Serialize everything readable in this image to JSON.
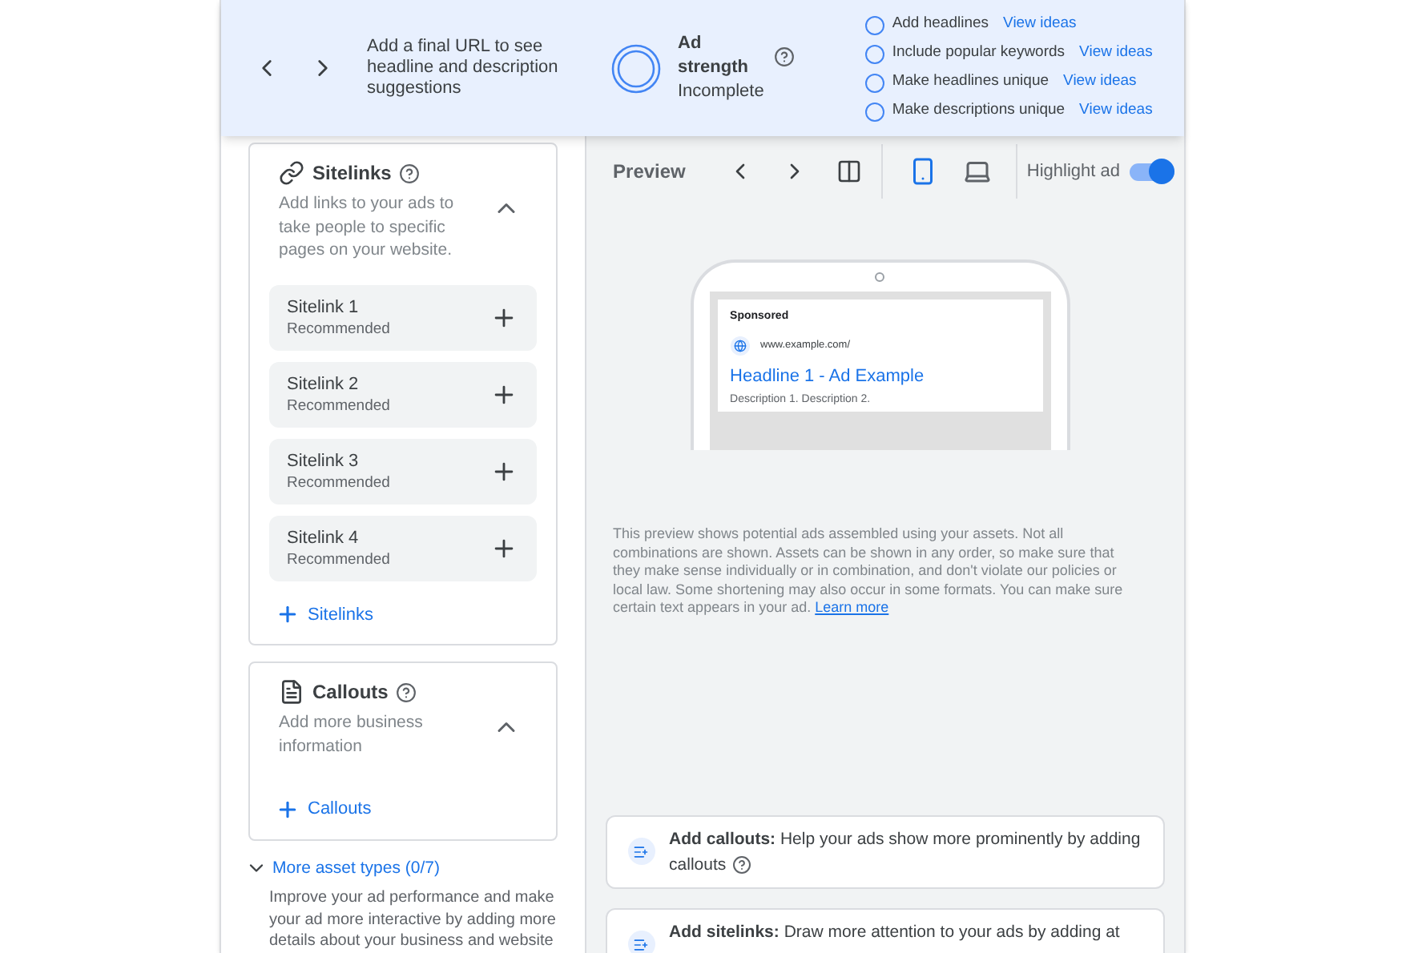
{
  "banner": {
    "suggestion": "Add a final URL to see headline and description suggestions",
    "strength_label": "Ad strength",
    "strength_status": "Incomplete",
    "checklist": [
      {
        "label": "Add headlines",
        "link": "View ideas",
        "checked": false
      },
      {
        "label": "Include popular keywords",
        "link": "View ideas",
        "checked": false
      },
      {
        "label": "Make headlines unique",
        "link": "View ideas",
        "checked": false
      },
      {
        "label": "Make descriptions unique",
        "link": "View ideas",
        "checked": false
      }
    ]
  },
  "asset_sections": [
    {
      "kind": "sitelinks",
      "title": "Sitelinks",
      "description": "Add links to your ads to take people to specific pages on your website.",
      "expanded": true,
      "items": [
        {
          "title": "Sitelink 1",
          "subtitle": "Recommended"
        },
        {
          "title": "Sitelink 2",
          "subtitle": "Recommended"
        },
        {
          "title": "Sitelink 3",
          "subtitle": "Recommended"
        },
        {
          "title": "Sitelink 4",
          "subtitle": "Recommended"
        }
      ],
      "add_label": "Sitelinks"
    },
    {
      "kind": "callouts",
      "title": "Callouts",
      "description": "Add more business information",
      "expanded": true,
      "add_label": "Callouts"
    }
  ],
  "more_assets": {
    "label": "More asset types (0/7)",
    "expanded": true,
    "description": "Improve your ad performance and make your ad more interactive by adding more details about your business and website"
  },
  "preview": {
    "title": "Preview",
    "devices": [
      {
        "kind": "mobile",
        "selected": true
      },
      {
        "kind": "desktop",
        "selected": false
      }
    ],
    "highlight": {
      "label": "Highlight ad",
      "on": true
    },
    "ad": {
      "sponsored": "Sponsored",
      "url": "www.example.com/",
      "headline": "Headline 1 - Ad Example",
      "description": "Description 1. Description 2."
    },
    "disclaimer": "This preview shows potential ads assembled using your assets. Not all combinations are shown. Assets can be shown in any order, so make sure that they make sense individually or in combination, and don't violate our policies or local law. Some shortening may also occur in some formats. You can make sure certain text appears in your ad.",
    "learn_more": "Learn more",
    "tips": [
      {
        "title": "Add callouts:",
        "text": "Help your ads show more prominently by adding callouts",
        "help": true
      },
      {
        "title": "Add sitelinks:",
        "text": "Draw more attention to your ads by adding at",
        "help": false
      }
    ]
  }
}
